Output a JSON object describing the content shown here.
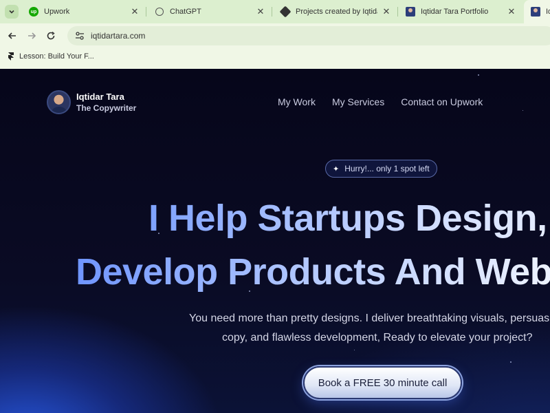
{
  "browser": {
    "tabs": [
      {
        "title": "Upwork",
        "favicon": "upwork-icon"
      },
      {
        "title": "ChatGPT",
        "favicon": "chatgpt-icon"
      },
      {
        "title": "Projects created by Iqtidar m",
        "favicon": "framer-icon"
      },
      {
        "title": "Iqtidar Tara Portfolio",
        "favicon": "portrait-icon"
      },
      {
        "title": "Iq",
        "favicon": "portrait-icon"
      }
    ],
    "url": "iqtidartara.com",
    "bookmarks": [
      {
        "label": "Lesson: Build Your F...",
        "icon": "framer-icon"
      }
    ],
    "chrome_color": "#f0f7e6"
  },
  "site": {
    "brand": {
      "name": "Iqtidar Tara",
      "role": "The Copywriter"
    },
    "nav": [
      "My Work",
      "My Services",
      "Contact on Upwork"
    ],
    "badge": "Hurry!... only 1 spot left",
    "headline": {
      "line1": "I Help Startups Design,",
      "line2": "Develop Products And Websites"
    },
    "subtitle": {
      "line1": "You need more than pretty designs. I deliver breathtaking visuals, persuasive",
      "line2": "copy, and flawless development, Ready to elevate your project?"
    },
    "cta": "Book a FREE 30 minute call",
    "accent_color": "#2f5fe8"
  }
}
